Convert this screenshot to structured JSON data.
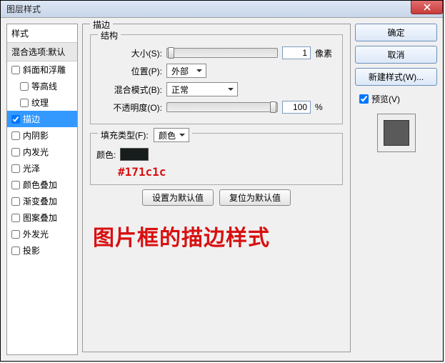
{
  "window": {
    "title": "图层样式"
  },
  "left": {
    "header": "样式",
    "subheader": "混合选项:默认",
    "items": [
      {
        "label": "斜面和浮雕",
        "checked": false,
        "indent": false
      },
      {
        "label": "等高线",
        "checked": false,
        "indent": true
      },
      {
        "label": "纹理",
        "checked": false,
        "indent": true
      },
      {
        "label": "描边",
        "checked": true,
        "indent": false,
        "active": true
      },
      {
        "label": "内阴影",
        "checked": false,
        "indent": false
      },
      {
        "label": "内发光",
        "checked": false,
        "indent": false
      },
      {
        "label": "光泽",
        "checked": false,
        "indent": false
      },
      {
        "label": "颜色叠加",
        "checked": false,
        "indent": false
      },
      {
        "label": "渐变叠加",
        "checked": false,
        "indent": false
      },
      {
        "label": "图案叠加",
        "checked": false,
        "indent": false
      },
      {
        "label": "外发光",
        "checked": false,
        "indent": false
      },
      {
        "label": "投影",
        "checked": false,
        "indent": false
      }
    ]
  },
  "center": {
    "group_title": "描边",
    "structure_title": "结构",
    "size_label": "大小(S):",
    "size_value": "1",
    "size_unit": "像素",
    "position_label": "位置(P):",
    "position_value": "外部",
    "blend_label": "混合模式(B):",
    "blend_value": "正常",
    "opacity_label": "不透明度(O):",
    "opacity_value": "100",
    "opacity_unit": "%",
    "filltype_label": "填充类型(F):",
    "filltype_value": "颜色",
    "color_label": "颜色:",
    "color_hex": "#171c1c",
    "btn_default": "设置为默认值",
    "btn_reset": "复位为默认值",
    "annotation": "图片框的描边样式"
  },
  "right": {
    "ok": "确定",
    "cancel": "取消",
    "newstyle": "新建样式(W)...",
    "preview_label": "预览(V)",
    "preview_checked": true
  }
}
